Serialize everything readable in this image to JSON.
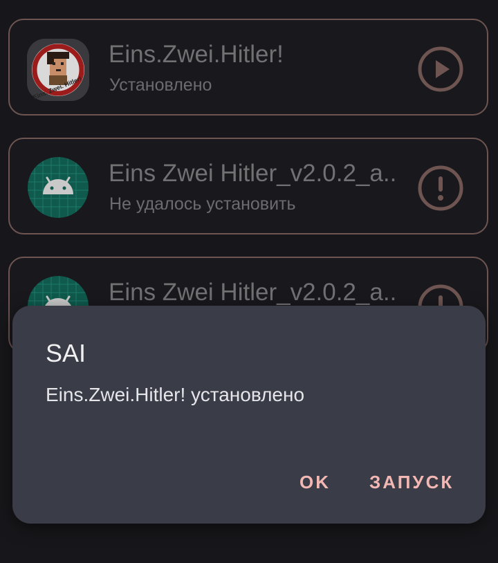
{
  "install_list": [
    {
      "title": "Eins.Zwei.Hitler!",
      "status": "Установлено",
      "icon": "app-logo-icon",
      "action_icon": "play-icon"
    },
    {
      "title": "Eins Zwei Hitler_v2.0.2_a..",
      "status": "Не удалось установить",
      "icon": "android-icon",
      "action_icon": "error-icon"
    },
    {
      "title": "Eins Zwei Hitler_v2.0.2_a..",
      "status": "",
      "icon": "android-icon",
      "action_icon": "error-icon"
    }
  ],
  "app_logo_text": "Eins. Zwei. Hitler!",
  "dialog": {
    "title": "SAI",
    "message": "Eins.Zwei.Hitler! установлено",
    "ok_label": "OK",
    "launch_label": "ЗАПУСК"
  },
  "colors": {
    "background": "#17171b",
    "card_border": "#6e5552",
    "dialog_bg": "#3a3d47",
    "accent": "#f4b8b4",
    "android_icon_bg": "#0f5a4c"
  }
}
